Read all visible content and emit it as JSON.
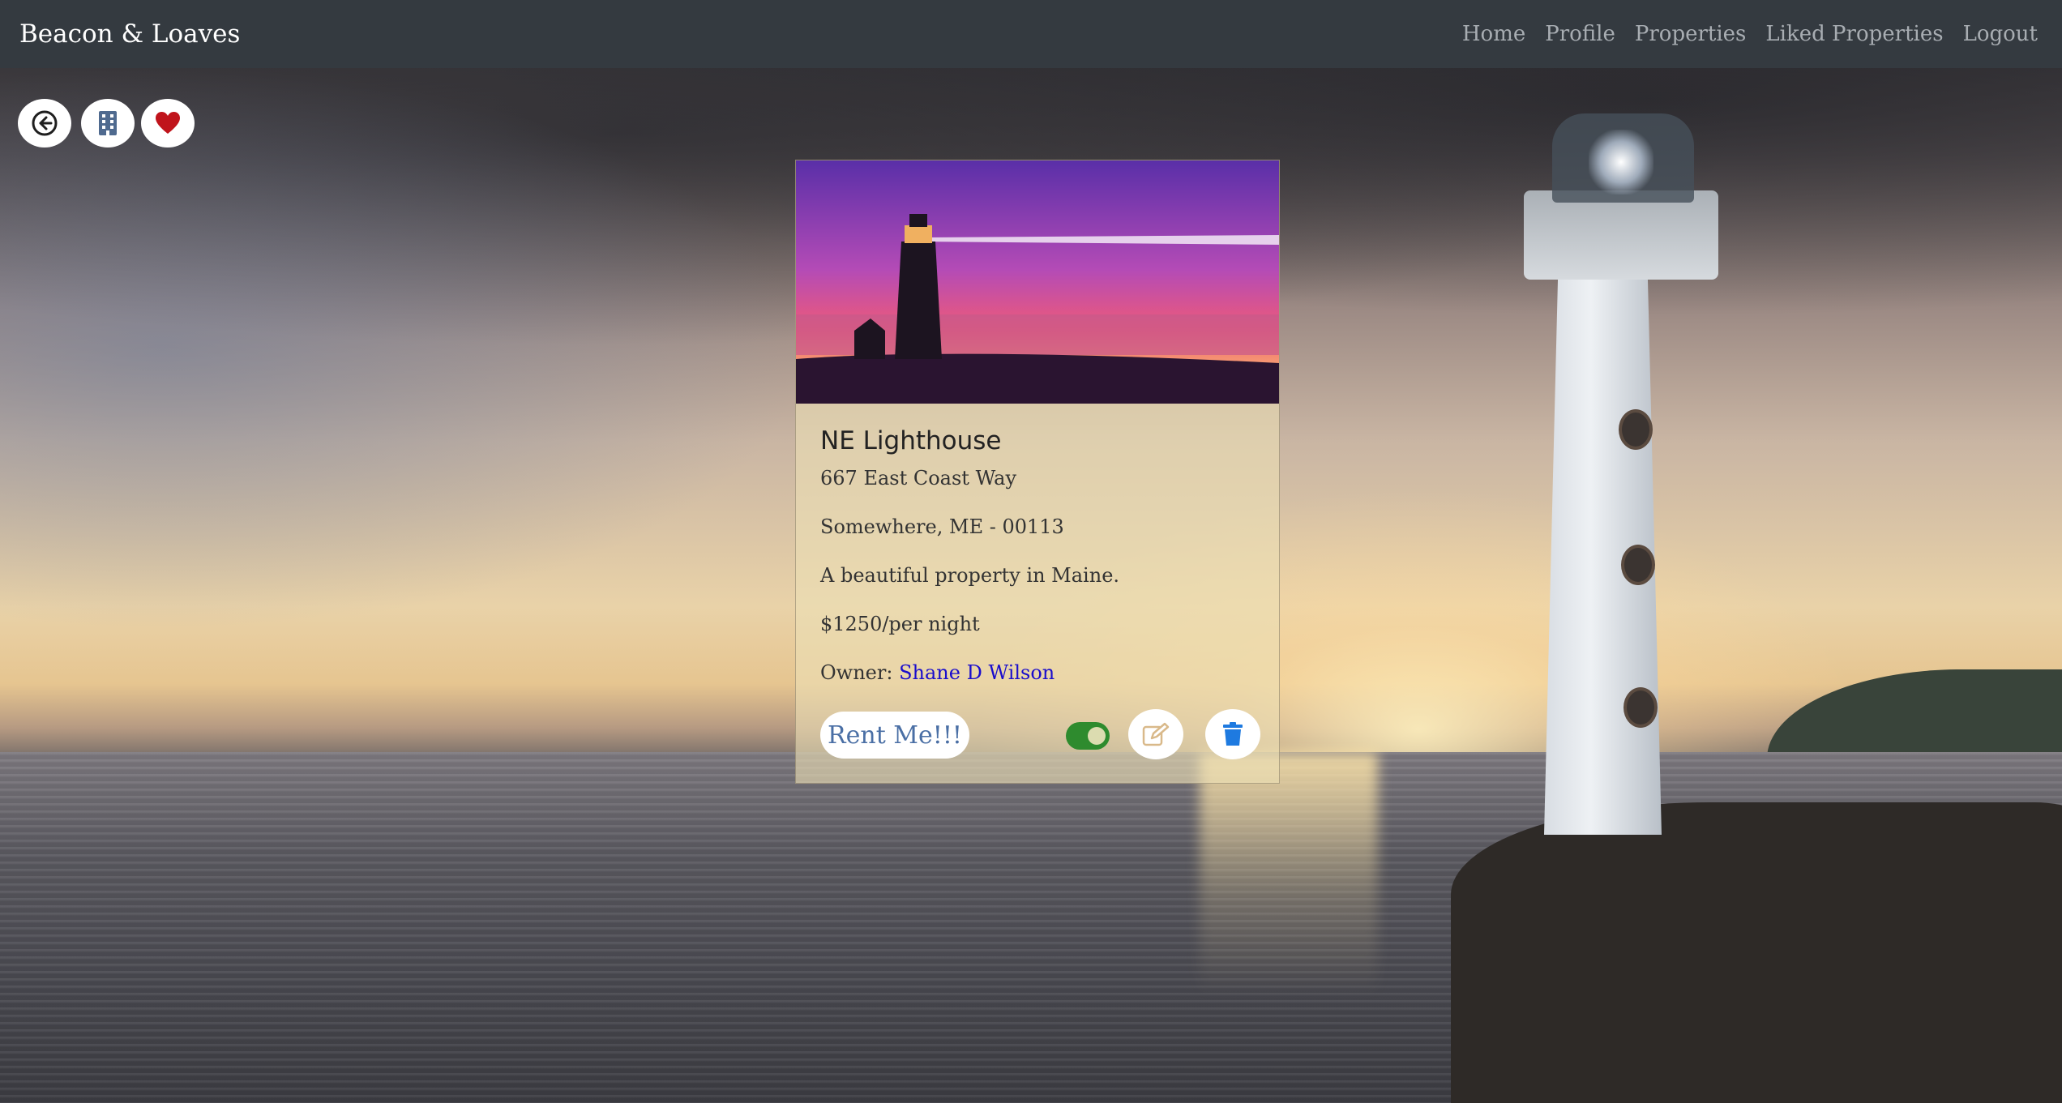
{
  "navbar": {
    "brand": "Beacon & Loaves",
    "links": [
      "Home",
      "Profile",
      "Properties",
      "Liked Properties",
      "Logout"
    ]
  },
  "toolbar": {
    "icons": [
      "back-arrow-icon",
      "building-icon",
      "heart-icon"
    ]
  },
  "card": {
    "title": "NE Lighthouse",
    "address_line1": "667 East Coast Way",
    "address_line2": "Somewhere, ME - 00113",
    "description": "A beautiful property in Maine.",
    "price": "$1250/per night",
    "owner_label": "Owner:",
    "owner_name": "Shane D Wilson",
    "rent_label": "Rent Me!!!",
    "toggle_on": true
  },
  "colors": {
    "navbar_bg": "#343a40",
    "nav_link": "#a8adb2",
    "toggle_on": "#2e8b2e",
    "heart": "#c0141b",
    "trash": "#1e7ae0",
    "owner_link": "#1a0dcc"
  }
}
